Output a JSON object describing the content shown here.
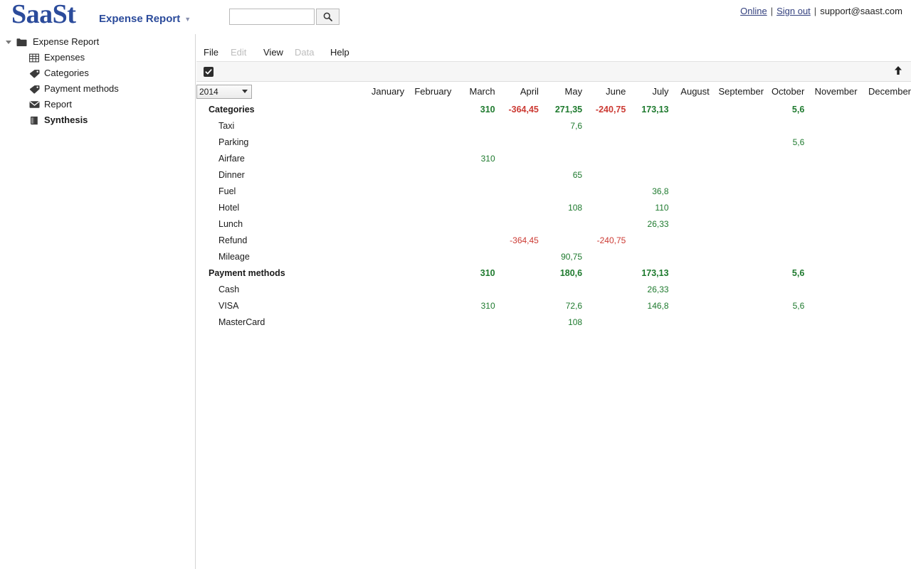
{
  "header": {
    "logo": "SaaSt",
    "app_title": "Expense Report",
    "title_caret": "chevron-down-icon",
    "search": {
      "value": "",
      "placeholder": "",
      "button_icon": "search-icon"
    },
    "links": {
      "online": "Online",
      "sep1": "|",
      "sign_out": "Sign out",
      "sep2": "|",
      "support": "support@saast.com"
    }
  },
  "sidebar": {
    "root": {
      "label": "Expense Report",
      "icon": "folder-icon",
      "caret": "caret-down-icon"
    },
    "items": [
      {
        "label": "Expenses",
        "icon": "table-grid-icon",
        "selected": false
      },
      {
        "label": "Categories",
        "icon": "tag-icon",
        "selected": false
      },
      {
        "label": "Payment methods",
        "icon": "tag-icon",
        "selected": false
      },
      {
        "label": "Report",
        "icon": "envelope-icon",
        "selected": false
      },
      {
        "label": "Synthesis",
        "icon": "book-icon",
        "selected": true
      }
    ]
  },
  "menubar": [
    {
      "label": "File",
      "disabled": false
    },
    {
      "label": "Edit",
      "disabled": true
    },
    {
      "label": "View",
      "disabled": false
    },
    {
      "label": "Data",
      "disabled": true
    },
    {
      "label": "Help",
      "disabled": false
    }
  ],
  "toolbar": {
    "select_all_checked": true,
    "select_all_icon": "checkbox-checked-icon",
    "export_icon": "arrow-up-icon"
  },
  "grid": {
    "year_selected": "2014",
    "year_options": [
      "2014"
    ],
    "months": [
      "January",
      "February",
      "March",
      "April",
      "May",
      "June",
      "July",
      "August",
      "September",
      "October",
      "November",
      "December"
    ],
    "colors": {
      "positive": "#1e7a2e",
      "negative": "#cc3a33"
    },
    "rows": [
      {
        "label": "Categories",
        "type": "group",
        "values": [
          "",
          "",
          "310",
          "-364,45",
          "271,35",
          "-240,75",
          "173,13",
          "",
          "",
          "5,6",
          "",
          ""
        ]
      },
      {
        "label": "Taxi",
        "type": "detail",
        "values": [
          "",
          "",
          "",
          "",
          "7,6",
          "",
          "",
          "",
          "",
          "",
          "",
          ""
        ]
      },
      {
        "label": "Parking",
        "type": "detail",
        "values": [
          "",
          "",
          "",
          "",
          "",
          "",
          "",
          "",
          "",
          "5,6",
          "",
          ""
        ]
      },
      {
        "label": "Airfare",
        "type": "detail",
        "values": [
          "",
          "",
          "310",
          "",
          "",
          "",
          "",
          "",
          "",
          "",
          "",
          ""
        ]
      },
      {
        "label": "Dinner",
        "type": "detail",
        "values": [
          "",
          "",
          "",
          "",
          "65",
          "",
          "",
          "",
          "",
          "",
          "",
          ""
        ]
      },
      {
        "label": "Fuel",
        "type": "detail",
        "values": [
          "",
          "",
          "",
          "",
          "",
          "",
          "36,8",
          "",
          "",
          "",
          "",
          ""
        ]
      },
      {
        "label": "Hotel",
        "type": "detail",
        "values": [
          "",
          "",
          "",
          "",
          "108",
          "",
          "110",
          "",
          "",
          "",
          "",
          ""
        ]
      },
      {
        "label": "Lunch",
        "type": "detail",
        "values": [
          "",
          "",
          "",
          "",
          "",
          "",
          "26,33",
          "",
          "",
          "",
          "",
          ""
        ]
      },
      {
        "label": "Refund",
        "type": "detail",
        "values": [
          "",
          "",
          "",
          "-364,45",
          "",
          "-240,75",
          "",
          "",
          "",
          "",
          "",
          ""
        ]
      },
      {
        "label": "Mileage",
        "type": "detail",
        "values": [
          "",
          "",
          "",
          "",
          "90,75",
          "",
          "",
          "",
          "",
          "",
          "",
          ""
        ]
      },
      {
        "label": "Payment methods",
        "type": "group",
        "values": [
          "",
          "",
          "310",
          "",
          "180,6",
          "",
          "173,13",
          "",
          "",
          "5,6",
          "",
          ""
        ]
      },
      {
        "label": "Cash",
        "type": "detail",
        "values": [
          "",
          "",
          "",
          "",
          "",
          "",
          "26,33",
          "",
          "",
          "",
          "",
          ""
        ]
      },
      {
        "label": "VISA",
        "type": "detail",
        "values": [
          "",
          "",
          "310",
          "",
          "72,6",
          "",
          "146,8",
          "",
          "",
          "5,6",
          "",
          ""
        ]
      },
      {
        "label": "MasterCard",
        "type": "detail",
        "values": [
          "",
          "",
          "",
          "",
          "108",
          "",
          "",
          "",
          "",
          "",
          "",
          ""
        ]
      }
    ]
  }
}
